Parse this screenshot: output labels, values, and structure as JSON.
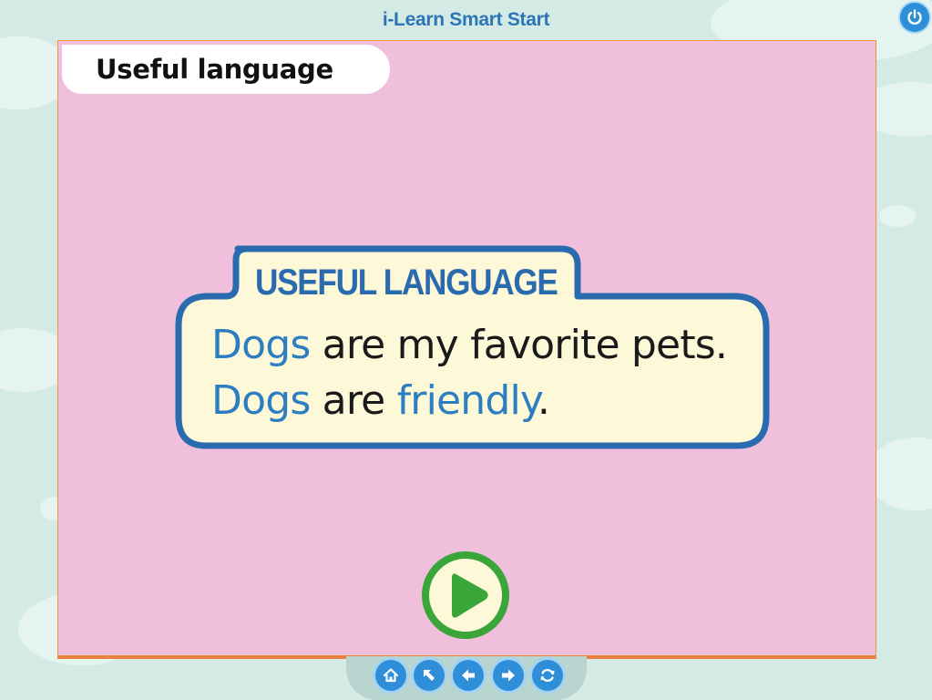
{
  "app": {
    "title": "i-Learn Smart Start"
  },
  "header": {
    "title": "Useful language"
  },
  "language_box": {
    "tag": "USEFUL LANGUAGE",
    "line1": {
      "subject": "Dogs",
      "rest": " are my favorite pets."
    },
    "line2": {
      "subject": "Dogs",
      "verb": " are ",
      "adjective": "friendly",
      "end": "."
    }
  },
  "icons": {
    "power": "power-icon",
    "play": "play-icon",
    "home": "home-icon",
    "back_to_start": "arrow-up-left-icon",
    "previous": "arrow-left-icon",
    "next": "arrow-right-icon",
    "replay": "refresh-icon"
  },
  "colors": {
    "background": "#d4ebe5",
    "stage": "#f0bfdb",
    "accent_blue": "#2d7dc2",
    "box_fill": "#fdf8d8",
    "play_green": "#3aa639"
  }
}
